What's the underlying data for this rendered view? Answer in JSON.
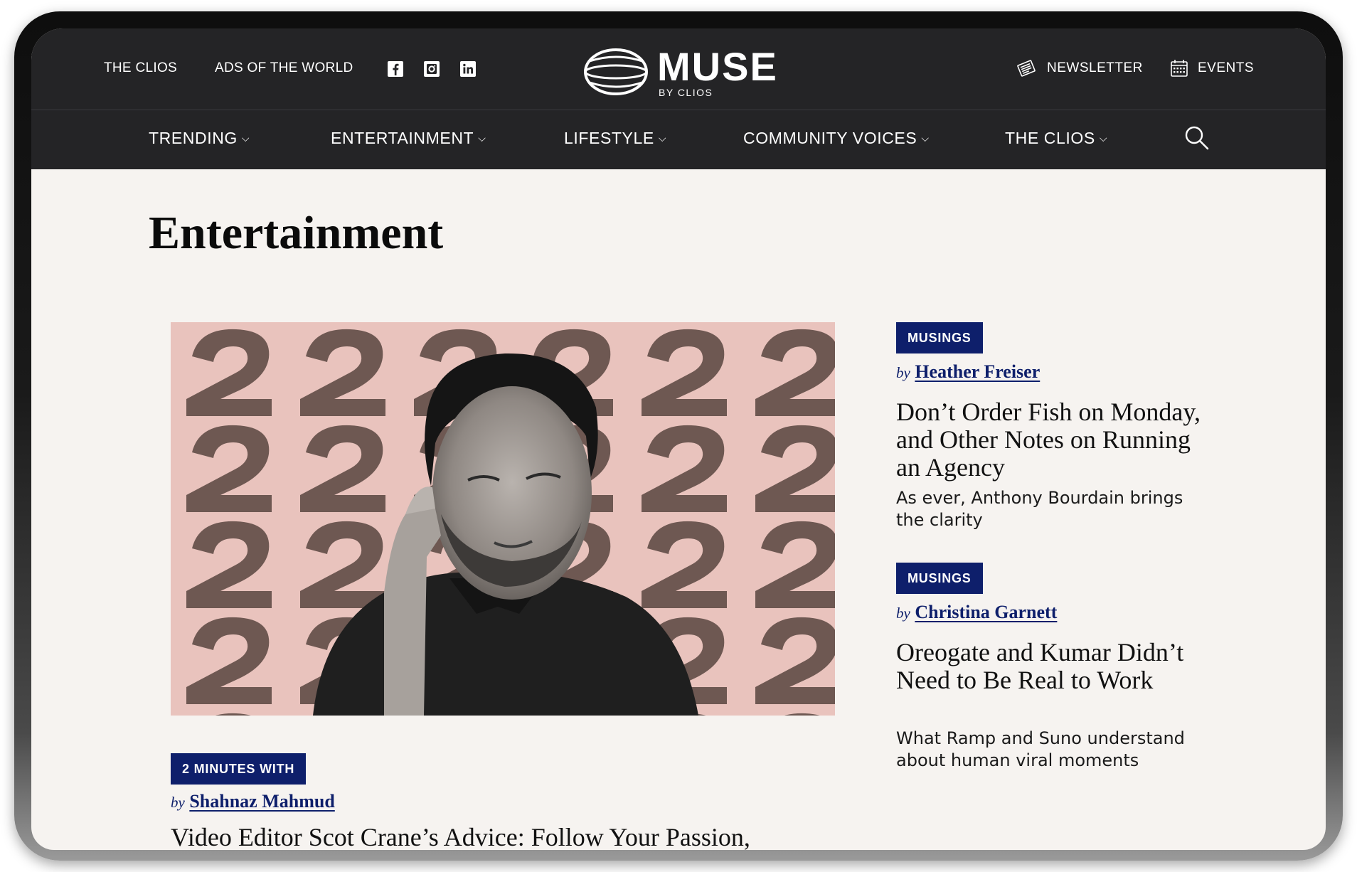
{
  "topbar": {
    "links": [
      "THE CLIOS",
      "ADS OF THE WORLD"
    ],
    "social": [
      "facebook-icon",
      "instagram-icon",
      "linkedin-icon"
    ],
    "logo_word": "MUSE",
    "logo_sub": "BY CLIOS",
    "newsletter_label": "NEWSLETTER",
    "events_label": "EVENTS"
  },
  "nav": {
    "items": [
      "TRENDING",
      "ENTERTAINMENT",
      "LIFESTYLE",
      "COMMUNITY VOICES",
      "THE CLIOS"
    ],
    "chevron": "⌵"
  },
  "page": {
    "title": "Entertainment"
  },
  "articles": [
    {
      "badge": "MUSINGS",
      "by": "by",
      "author": "Heather Freiser",
      "headline": "Don’t Order Fish on Monday, and Other Notes on Running an Agency",
      "dek": "As ever, Anthony Bourdain brings the clarity"
    },
    {
      "badge": "MUSINGS",
      "by": "by",
      "author": "Christina Garnett",
      "headline": "Oreogate and Kumar Didn’t Need to Be Real to Work",
      "dek": "What Ramp and Suno understand about human viral moments"
    }
  ],
  "hero": {
    "badge": "2 MINUTES WITH",
    "by": "by",
    "author": "Shahnaz Mahmud",
    "headline": "Video Editor Scot Crane’s Advice: Follow Your Passion, Wherever It Leads"
  },
  "colors": {
    "chrome": "#242426",
    "badge": "#0e1f6b",
    "background": "#f6f3f0",
    "hero_pink": "#e9c3bd",
    "hero_brown": "#6e5852"
  }
}
